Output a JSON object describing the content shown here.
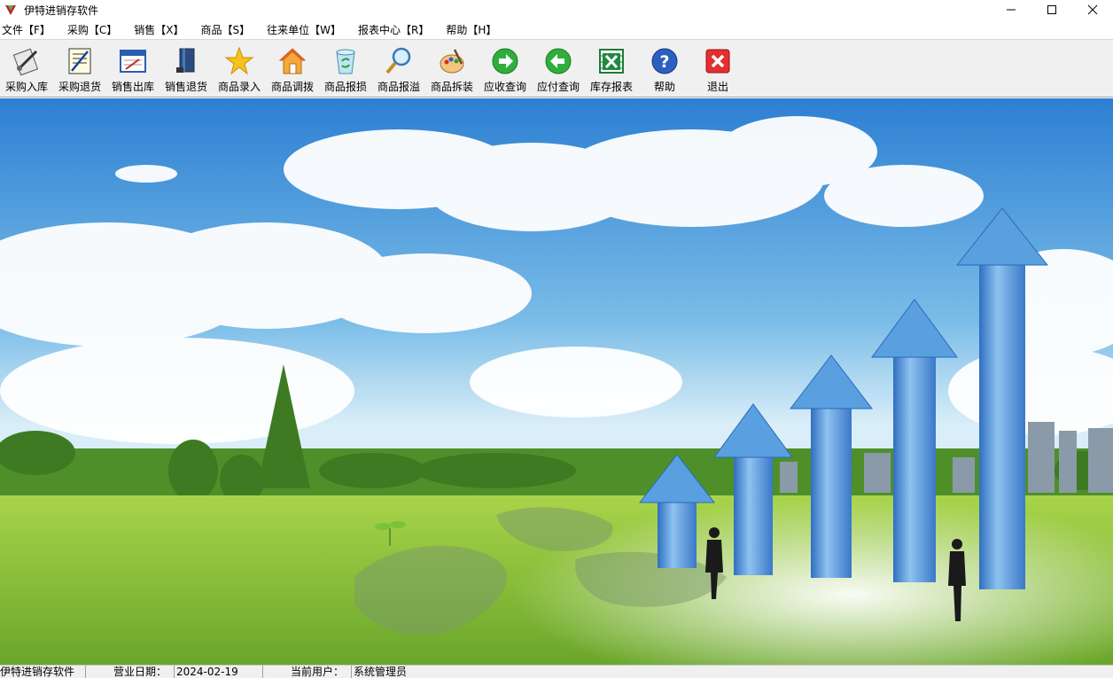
{
  "window": {
    "title": "伊特进销存软件"
  },
  "menu": [
    {
      "label": "文件【F】"
    },
    {
      "label": "采购【C】"
    },
    {
      "label": "销售【X】"
    },
    {
      "label": "商品【S】"
    },
    {
      "label": "往来单位【W】"
    },
    {
      "label": "报表中心【R】"
    },
    {
      "label": "帮助【H】"
    }
  ],
  "toolbar": [
    {
      "label": "采购入库",
      "icon": "purchase-in-icon"
    },
    {
      "label": "采购退货",
      "icon": "purchase-return-icon"
    },
    {
      "label": "销售出库",
      "icon": "sales-out-icon"
    },
    {
      "label": "销售退货",
      "icon": "sales-return-icon"
    },
    {
      "label": "商品录入",
      "icon": "star-icon"
    },
    {
      "label": "商品调拨",
      "icon": "house-icon"
    },
    {
      "label": "商品报损",
      "icon": "recycle-bin-icon"
    },
    {
      "label": "商品报溢",
      "icon": "magnifier-icon"
    },
    {
      "label": "商品拆装",
      "icon": "palette-icon"
    },
    {
      "label": "应收查询",
      "icon": "green-arrow-right-icon"
    },
    {
      "label": "应付查询",
      "icon": "green-arrow-left-icon"
    },
    {
      "label": "库存报表",
      "icon": "excel-icon"
    },
    {
      "label": "帮助",
      "icon": "help-icon"
    },
    {
      "label": "退出",
      "icon": "exit-icon"
    }
  ],
  "statusbar": {
    "app_name": "伊特进销存软件",
    "date_label": "营业日期：",
    "date_value": "2024-02-19",
    "user_label": "当前用户：",
    "user_value": "系统管理员"
  },
  "colors": {
    "toolbar_bg": "#f0f0f0",
    "sky_top": "#3a8fd8",
    "grass": "#8cc63f",
    "arrow_blue": "#4a8fd6"
  }
}
